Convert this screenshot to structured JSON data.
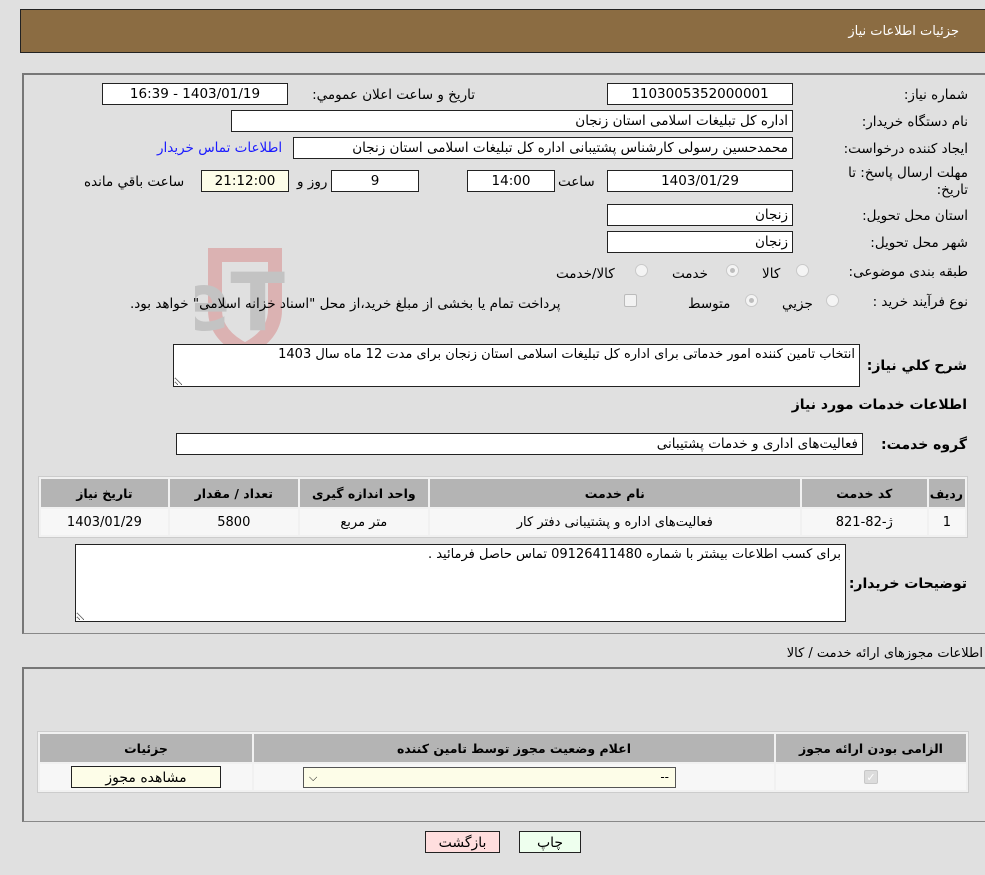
{
  "header": {
    "title": "جزئیات اطلاعات نیاز"
  },
  "form": {
    "need_number": {
      "label": "شماره نیاز:",
      "value": "1103005352000001"
    },
    "announce_datetime": {
      "label": "تاریخ و ساعت اعلان عمومي:",
      "value": "1403/01/19 - 16:39"
    },
    "buyer_org": {
      "label": "نام دستگاه خريدار:",
      "value": "اداره کل تبلیغات اسلامی استان زنجان"
    },
    "requester": {
      "label": "ایجاد کننده درخواست:",
      "value": "محمدحسین رسولی کارشناس پشتیبانی  اداره کل تبلیغات اسلامی استان زنجان"
    },
    "buyer_contact_link": "اطلاعات تماس خریدار",
    "deadline": {
      "label_line1": "مهلت ارسال پاسخ: تا",
      "label_line2": "تاریخ:",
      "date": "1403/01/29",
      "time_label": "ساعت",
      "time": "14:00",
      "days": "9",
      "days_label": "روز و",
      "remaining": "21:12:00",
      "remaining_label": "ساعت باقي مانده"
    },
    "delivery_province": {
      "label": "استان محل تحویل:",
      "value": "زنجان"
    },
    "delivery_city": {
      "label": "شهر محل تحویل:",
      "value": "زنجان"
    },
    "category": {
      "label": "طبقه بندی موضوعی:",
      "options": [
        "کالا",
        "خدمت",
        "کالا/خدمت"
      ],
      "selected": "خدمت"
    },
    "purchase_type": {
      "label": "نوع فرآیند خرید :",
      "options": [
        "جزيي",
        "متوسط"
      ],
      "selected": "متوسط",
      "treasury_note": "پرداخت تمام یا بخشی از مبلغ خرید،از محل \"اسناد خزانه اسلامی\" خواهد بود."
    },
    "summary": {
      "label": "شرح كلي نياز:",
      "value": "انتخاب تامین کننده امور خدماتی برای اداره کل تبلیغات اسلامی استان زنجان برای مدت 12 ماه سال 1403"
    },
    "services_title": "اطلاعات خدمات مورد نیاز",
    "service_group": {
      "label": "گروه خدمت:",
      "value": "فعالیت‌های اداری و خدمات پشتیبانی"
    }
  },
  "services_table": {
    "headers": [
      "ردیف",
      "کد خدمت",
      "نام خدمت",
      "واحد اندازه گیری",
      "تعداد / مقدار",
      "تاریخ نیاز"
    ],
    "rows": [
      [
        "1",
        "ژ-82-821",
        "فعالیت‌های اداره و پشتیبانی دفتر کار",
        "متر مربع",
        "5800",
        "1403/01/29"
      ]
    ]
  },
  "buyer_notes": {
    "label": "توضیحات خریدار:",
    "value": "برای کسب اطلاعات بیشتر با شماره 09126411480 تماس حاصل فرمائید ."
  },
  "licenses": {
    "title": "اطلاعات مجوزهای ارائه خدمت / کالا",
    "headers": [
      "الزامی بودن ارائه مجوز",
      "اعلام وضعیت مجوز توسط تامین کننده",
      "جزئیات"
    ],
    "row": {
      "required": true,
      "status_selected": "--",
      "details_button": "مشاهده مجوز"
    }
  },
  "buttons": {
    "print": "چاپ",
    "back": "بازگشت"
  },
  "colors": {
    "header_bg": "#8b6c42",
    "link": "#1a1aff",
    "back_btn": "#ffdede",
    "print_btn": "#eeffee"
  }
}
